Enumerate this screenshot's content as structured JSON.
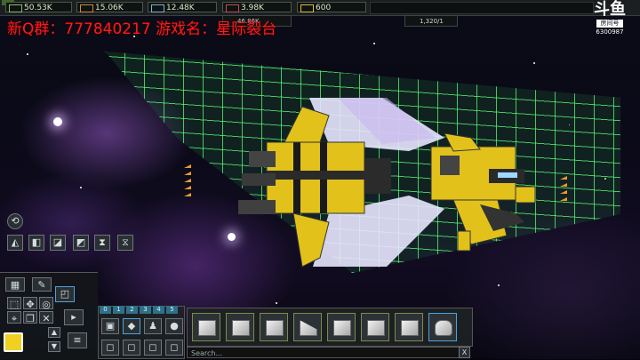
{
  "resources": [
    {
      "name": "resource-1",
      "value": "50.53K",
      "color": "#8fb86a"
    },
    {
      "name": "resource-2",
      "value": "15.06K",
      "color": "#d08a3a"
    },
    {
      "name": "resource-3",
      "value": "12.48K",
      "color": "#7fb0d0"
    },
    {
      "name": "resource-4",
      "value": "3.98K",
      "color": "#c05050"
    },
    {
      "name": "resource-5",
      "value": "600",
      "color": "#d8c040"
    }
  ],
  "secondary_hud": [
    {
      "value": "46.86K"
    },
    {
      "value": "1,320/1"
    }
  ],
  "overlay": {
    "text": "新Q群：777840217  游戏名：星际裂台"
  },
  "logo": {
    "room_label": "房间号",
    "room_number": "6300987"
  },
  "search": {
    "placeholder": "Search..."
  },
  "palette_tabs": [
    "0",
    "1",
    "2",
    "3",
    "4",
    "5"
  ],
  "search_close": "X"
}
